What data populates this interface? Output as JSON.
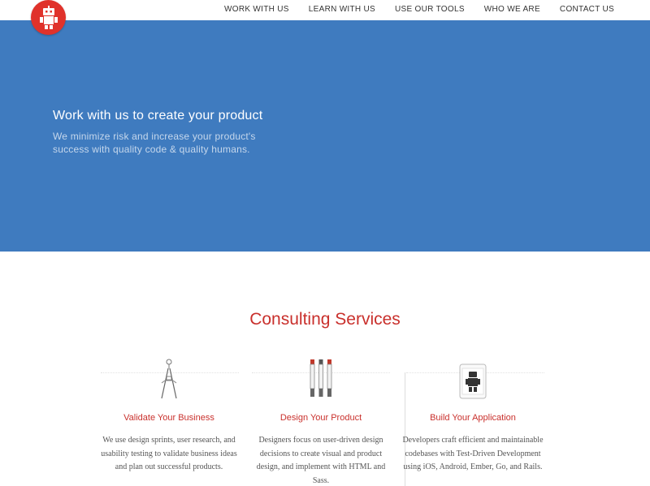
{
  "nav": {
    "items": [
      {
        "label": "WORK WITH US"
      },
      {
        "label": "LEARN WITH US"
      },
      {
        "label": "USE OUR TOOLS"
      },
      {
        "label": "WHO WE ARE"
      },
      {
        "label": "CONTACT US"
      }
    ]
  },
  "hero": {
    "title": "Work with us to create your product",
    "subtitle": "We minimize risk and increase your product's success with quality code & quality humans."
  },
  "services": {
    "title": "Consulting Services",
    "items": [
      {
        "icon": "compass-icon",
        "title": "Validate Your Business",
        "description": "We use design sprints, user research, and usability testing to validate business ideas and plan out successful products."
      },
      {
        "icon": "markers-icon",
        "title": "Design Your Product",
        "description": "Designers focus on user-driven design decisions to create visual and product design, and implement with HTML and Sass."
      },
      {
        "icon": "robot-phone-icon",
        "title": "Build Your Application",
        "description": "Developers craft efficient and maintainable codebases with Test-Driven Development using iOS, Android, Ember, Go, and Rails."
      }
    ]
  },
  "colors": {
    "brand_red": "#e0322b",
    "hero_blue": "#3f7bbf",
    "heading_red": "#c9302c"
  }
}
